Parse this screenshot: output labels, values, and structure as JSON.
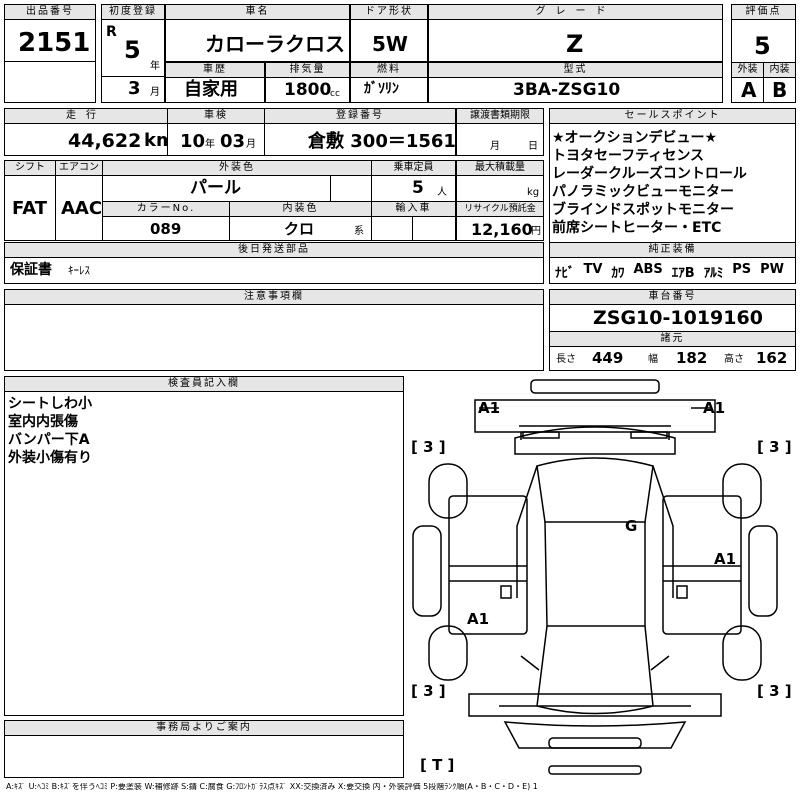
{
  "headers": {
    "lot_no": "出品番号",
    "first_reg": "初度登録",
    "model_name": "車名",
    "door": "ドア形状",
    "grade": "グレード",
    "score": "評価点",
    "history": "車歴",
    "displacement": "排気量",
    "fuel": "燃料",
    "type": "型式",
    "exterior": "外装",
    "interior": "内装",
    "mileage": "走行",
    "inspection": "車検",
    "reg_no": "登録番号",
    "transfer": "譲渡書類期限",
    "sales_points": "セールスポイント",
    "shift": "シフト",
    "aircon": "エアコン",
    "ext_color": "外装色",
    "capacity": "乗車定員",
    "max_load": "最大積載量",
    "color_no": "カラーNo.",
    "int_color": "内装色",
    "import": "輸入車",
    "recycle": "リサイクル預託金",
    "later_parts": "後日発送部品",
    "genuine": "純正装備",
    "notes": "注意事項欄",
    "chassis": "車台番号",
    "specs": "諸元",
    "inspector": "検査員記入欄",
    "office": "事務局よりご案内"
  },
  "lot": {
    "number": "2151"
  },
  "first_reg": {
    "era": "R",
    "year": "5",
    "year_unit": "年",
    "month": "3",
    "month_unit": "月"
  },
  "model": {
    "name": "カローラクロス"
  },
  "door": {
    "value": "5W"
  },
  "grade": {
    "value": "Z"
  },
  "score": {
    "overall": "5",
    "exterior": "A",
    "interior": "B"
  },
  "history": {
    "value": "自家用"
  },
  "displacement": {
    "value": "1800",
    "unit": "cc"
  },
  "fuel": {
    "value": "ｶﾞｿﾘﾝ"
  },
  "type": {
    "value": "3BA-ZSG10"
  },
  "mileage": {
    "value": "44,622",
    "unit": "km"
  },
  "inspection": {
    "year": "10",
    "year_unit": "年",
    "month": "03",
    "month_unit": "月"
  },
  "reg_no": {
    "value": "倉敷 300＝1561"
  },
  "transfer": {
    "month_unit": "月",
    "day_unit": "日"
  },
  "sales_points": [
    "★オークションデビュー★",
    "トヨタセーフティセンス",
    "レーダークルーズコントロール",
    "パノラミックビューモニター",
    "ブラインドスポットモニター",
    "前席シートヒーター・ETC"
  ],
  "shift": {
    "value": "FAT"
  },
  "aircon": {
    "value": "AAC"
  },
  "ext_color": {
    "value": "パール"
  },
  "capacity": {
    "value": "5",
    "unit": "人"
  },
  "max_load": {
    "unit": "kg"
  },
  "color_no": {
    "value": "089"
  },
  "int_color": {
    "value": "クロ",
    "unit": "系"
  },
  "recycle": {
    "value": "12,160",
    "unit": "円"
  },
  "later_parts": {
    "value": "保証書",
    "extra": "ｷｰﾚｽ"
  },
  "genuine": {
    "items": [
      "ﾅﾋﾞ",
      "TV",
      "ｶﾜ",
      "ABS",
      "ｴｱB",
      "ｱﾙﾐ",
      "PS",
      "PW"
    ]
  },
  "chassis": {
    "value": "ZSG10-1019160"
  },
  "specs": {
    "length_label": "長さ",
    "length": "449",
    "width_label": "幅",
    "width": "182",
    "height_label": "高さ",
    "height": "162"
  },
  "inspector": {
    "notes": [
      "シートしわ小",
      "室内内張傷",
      "バンパー下A",
      "外装小傷有り"
    ]
  },
  "diagram": {
    "marks": {
      "front_left": "A1",
      "front_right": "A1",
      "roof": "G",
      "right_side": "A1",
      "left_rear": "A1"
    },
    "bracket_labels": [
      "[ 3 ]",
      "[ 3 ]",
      "[ 3 ]",
      "[ 3 ]",
      "[ T ]"
    ]
  },
  "legend": {
    "text": "A:ｷｽﾞ U:ﾍｺﾐ B:ｷｽﾞを伴うﾍｺﾐ P:要塗装 W:補修跡 S:錆 C:腐食 G:ﾌﾛﾝﾄｶﾞﾗｽ点ｷｽﾞ XX:交換済み X:要交換 内・外装評価 5段階ﾗﾝｸ順(A・B・C・D・E) 1"
  }
}
